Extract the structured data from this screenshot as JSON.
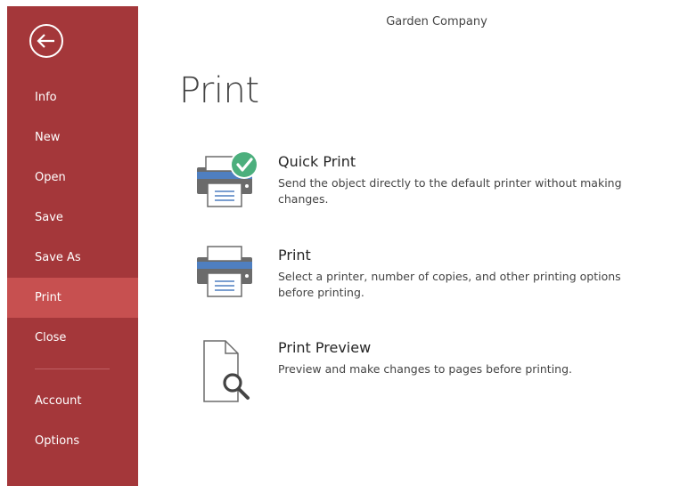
{
  "app": {
    "document_title": "Garden Company"
  },
  "sidebar": {
    "back_icon": "back-arrow-circle-icon",
    "items": [
      {
        "label": "Info"
      },
      {
        "label": "New"
      },
      {
        "label": "Open"
      },
      {
        "label": "Save"
      },
      {
        "label": "Save As"
      },
      {
        "label": "Print",
        "active": true
      },
      {
        "label": "Close"
      },
      {
        "label": "Account"
      },
      {
        "label": "Options"
      }
    ]
  },
  "main": {
    "heading": "Print",
    "options": [
      {
        "title": "Quick Print",
        "description": "Send the object directly to the default printer without making changes.",
        "icon": "printer-check-icon"
      },
      {
        "title": "Print",
        "description": "Select a printer, number of copies, and other printing options before printing.",
        "icon": "printer-icon"
      },
      {
        "title": "Print Preview",
        "description": "Preview and make changes to pages before printing.",
        "icon": "print-preview-icon"
      }
    ]
  },
  "colors": {
    "sidebar_bg": "#a4373a",
    "sidebar_active": "#c75050",
    "check_green": "#4caf7d",
    "printer_blue": "#4f7fc0"
  }
}
